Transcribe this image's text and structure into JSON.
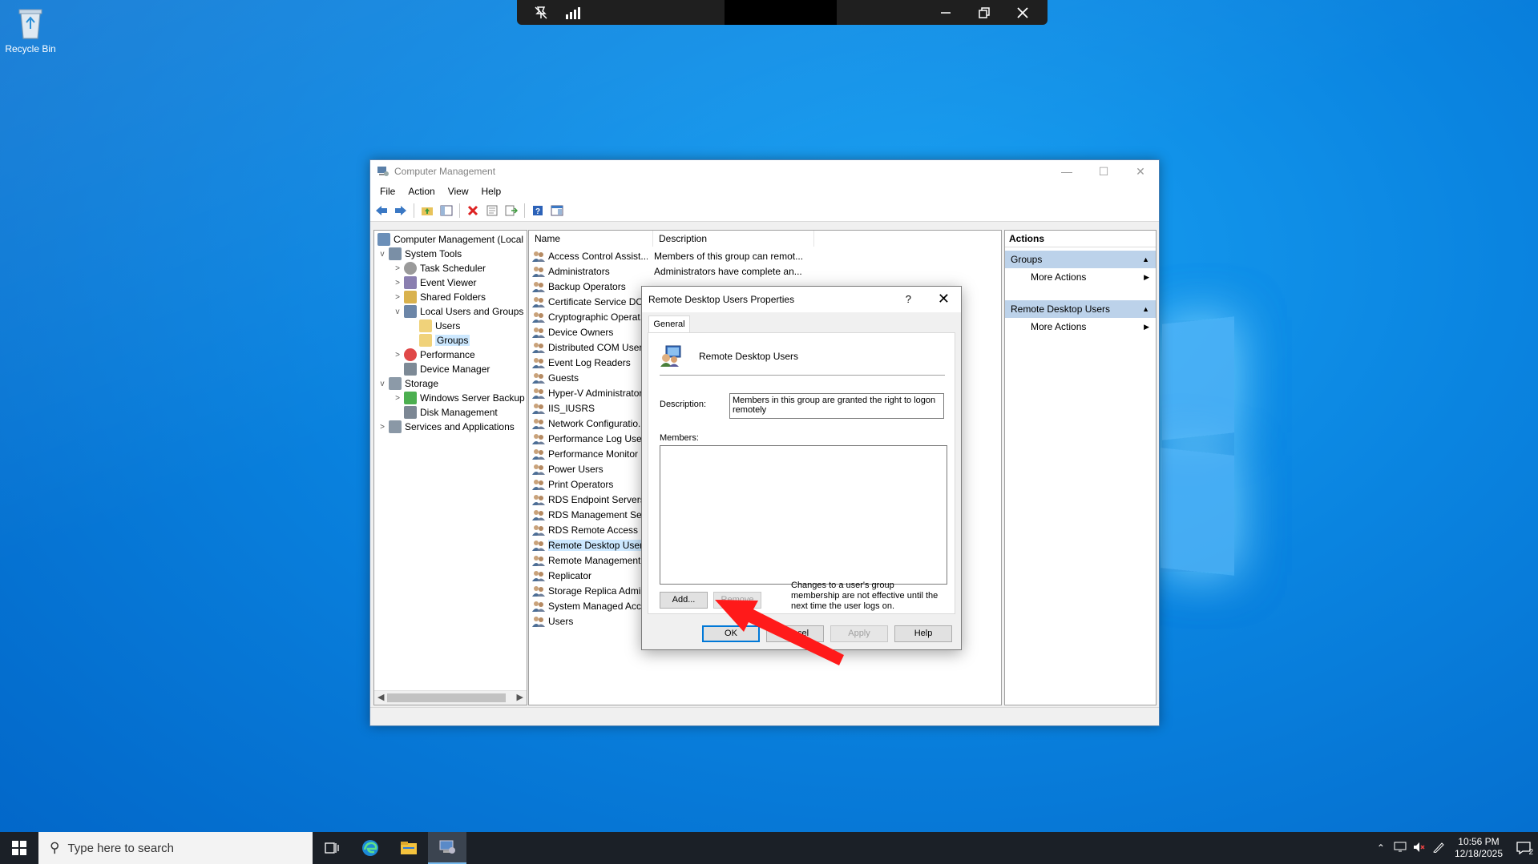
{
  "desktop": {
    "icons": [
      {
        "label": "Recycle Bin",
        "icon": "recycle-bin-icon"
      }
    ]
  },
  "rdp_bar": {
    "pin_icon": "unpin-icon",
    "signal_icon": "connection-bars-icon",
    "buttons": [
      "minimize",
      "restore",
      "close"
    ]
  },
  "window": {
    "title": "Computer Management",
    "menu": [
      "File",
      "Action",
      "View",
      "Help"
    ],
    "toolbar": [
      "back-icon",
      "forward-icon",
      "up-folder-icon",
      "show-hide-tree-icon",
      "delete-icon",
      "properties-icon",
      "export-icon",
      "help-icon",
      "console-view-icon"
    ]
  },
  "tree": {
    "root": "Computer Management (Local",
    "items": [
      {
        "label": "System Tools",
        "level": 1,
        "expander": "v"
      },
      {
        "label": "Task Scheduler",
        "level": 2,
        "expander": ">"
      },
      {
        "label": "Event Viewer",
        "level": 2,
        "expander": ">"
      },
      {
        "label": "Shared Folders",
        "level": 2,
        "expander": ">"
      },
      {
        "label": "Local Users and Groups",
        "level": 2,
        "expander": "v"
      },
      {
        "label": "Users",
        "level": 3,
        "expander": ""
      },
      {
        "label": "Groups",
        "level": 3,
        "expander": "",
        "selected": true
      },
      {
        "label": "Performance",
        "level": 2,
        "expander": ">"
      },
      {
        "label": "Device Manager",
        "level": 2,
        "expander": ""
      },
      {
        "label": "Storage",
        "level": 1,
        "expander": "v"
      },
      {
        "label": "Windows Server Backup",
        "level": 2,
        "expander": ">"
      },
      {
        "label": "Disk Management",
        "level": 2,
        "expander": ""
      },
      {
        "label": "Services and Applications",
        "level": 1,
        "expander": ">"
      }
    ]
  },
  "list": {
    "columns": [
      "Name",
      "Description"
    ],
    "rows": [
      {
        "name": "Access Control Assist...",
        "desc": "Members of this group can remot..."
      },
      {
        "name": "Administrators",
        "desc": "Administrators have complete an..."
      },
      {
        "name": "Backup Operators",
        "desc": ""
      },
      {
        "name": "Certificate Service DC...",
        "desc": ""
      },
      {
        "name": "Cryptographic Operat...",
        "desc": ""
      },
      {
        "name": "Device Owners",
        "desc": ""
      },
      {
        "name": "Distributed COM Users",
        "desc": ""
      },
      {
        "name": "Event Log Readers",
        "desc": ""
      },
      {
        "name": "Guests",
        "desc": ""
      },
      {
        "name": "Hyper-V Administrators",
        "desc": ""
      },
      {
        "name": "IIS_IUSRS",
        "desc": ""
      },
      {
        "name": "Network Configuratio...",
        "desc": ""
      },
      {
        "name": "Performance Log Users",
        "desc": ""
      },
      {
        "name": "Performance Monitor ...",
        "desc": ""
      },
      {
        "name": "Power Users",
        "desc": ""
      },
      {
        "name": "Print Operators",
        "desc": ""
      },
      {
        "name": "RDS Endpoint Servers",
        "desc": ""
      },
      {
        "name": "RDS Management Ser...",
        "desc": ""
      },
      {
        "name": "RDS Remote Access S...",
        "desc": ""
      },
      {
        "name": "Remote Desktop Users",
        "desc": "",
        "selected": true
      },
      {
        "name": "Remote Management...",
        "desc": ""
      },
      {
        "name": "Replicator",
        "desc": ""
      },
      {
        "name": "Storage Replica Admi...",
        "desc": ""
      },
      {
        "name": "System Managed Acc...",
        "desc": ""
      },
      {
        "name": "Users",
        "desc": ""
      }
    ]
  },
  "actions": {
    "title": "Actions",
    "sections": [
      {
        "header": "Groups",
        "item": "More Actions"
      },
      {
        "header": "Remote Desktop Users",
        "item": "More Actions"
      }
    ]
  },
  "dialog": {
    "title": "Remote Desktop Users Properties",
    "help_glyph": "?",
    "tab": "General",
    "group_name": "Remote Desktop Users",
    "description_label": "Description:",
    "description_value": "Members in this group are granted the right to logon remotely",
    "members_label": "Members:",
    "add_label": "Add...",
    "remove_label": "Remove",
    "note": "Changes to a user's group membership are not effective until the next time the user logs on.",
    "ok_label": "OK",
    "cancel_label": "Cancel",
    "apply_label": "Apply",
    "help_label": "Help"
  },
  "annotation": {
    "type": "red-arrow",
    "points_to": "add-button"
  },
  "taskbar": {
    "search_placeholder": "Type here to search",
    "apps": [
      "task-view-icon",
      "edge-icon",
      "file-explorer-icon",
      "computer-management-icon"
    ],
    "time": "10:56 PM",
    "date": "12/18/2025",
    "notification_count": "2"
  },
  "colors": {
    "desktop": "#0a84e0",
    "selection": "#cce8ff",
    "action_header": "#bcd2ea",
    "arrow": "#ff1a1a",
    "taskbar": "#1b2027"
  }
}
